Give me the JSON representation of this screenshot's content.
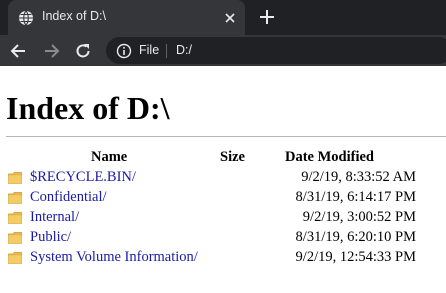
{
  "browser": {
    "tab_title": "Index of D:\\",
    "omnibox_scheme": "File",
    "omnibox_url": "D:/",
    "icons": {
      "favicon": "globe-icon",
      "close": "close-icon",
      "new_tab": "plus-icon",
      "back": "back-arrow-icon",
      "forward": "forward-arrow-icon",
      "reload": "reload-icon",
      "info": "info-icon"
    },
    "colors": {
      "tabstrip": "#202124",
      "active_tab": "#35363a",
      "text": "#e8eaed"
    }
  },
  "page": {
    "title": "Index of D:\\",
    "columns": {
      "name": "Name",
      "size": "Size",
      "date_modified": "Date Modified"
    },
    "link_color": "#1a1aa6",
    "folder_icon": "folder-icon",
    "rows": [
      {
        "name": "$RECYCLE.BIN/",
        "size": "",
        "date": "9/2/19, 8:33:52 AM"
      },
      {
        "name": "Confidential/",
        "size": "",
        "date": "8/31/19, 6:14:17 PM"
      },
      {
        "name": "Internal/",
        "size": "",
        "date": "9/2/19, 3:00:52 PM"
      },
      {
        "name": "Public/",
        "size": "",
        "date": "8/31/19, 6:20:10 PM"
      },
      {
        "name": "System Volume Information/",
        "size": "",
        "date": "9/2/19, 12:54:33 PM"
      }
    ]
  }
}
